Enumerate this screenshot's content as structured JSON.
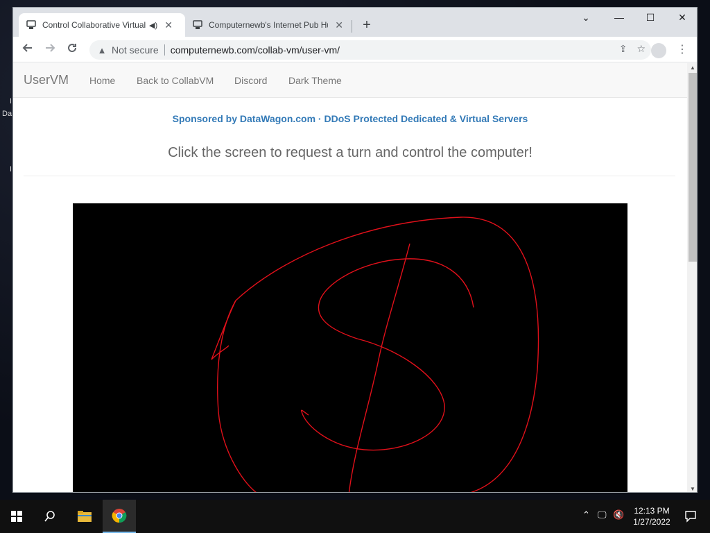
{
  "desktop": {
    "edge_text_1": "I",
    "edge_text_2": "Da",
    "edge_text_3": "I"
  },
  "browser": {
    "tabs": [
      {
        "title": "Control Collaborative Virtual",
        "active": true,
        "playing_audio": true
      },
      {
        "title": "Computernewb's Internet Pub Hub",
        "active": false,
        "playing_audio": false
      }
    ],
    "new_tab_label": "+",
    "window_controls": {
      "tab_search": "⌄",
      "minimize": "—",
      "maximize": "☐",
      "close": "✕"
    },
    "omnibox": {
      "security_text": "Not secure",
      "url": "computernewb.com/collab-vm/user-vm/"
    }
  },
  "page": {
    "brand": "UserVM",
    "nav_links": [
      "Home",
      "Back to CollabVM",
      "Discord",
      "Dark Theme"
    ],
    "sponsor_text": "Sponsored by DataWagon.com · DDoS Protected Dedicated & Virtual Servers",
    "instructions": "Click the screen to request a turn and control the computer!",
    "vm_screen": {
      "background": "#000000",
      "drawing_color": "#e0101a"
    }
  },
  "taskbar": {
    "clock_time": "12:13 PM",
    "clock_date": "1/27/2022"
  },
  "colors": {
    "link_blue": "#337ab7",
    "nav_text": "#777777",
    "taskbar": "#101010"
  }
}
